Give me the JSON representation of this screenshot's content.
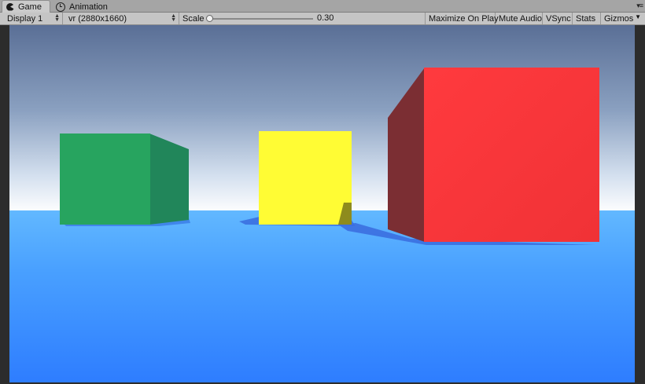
{
  "tabs": [
    {
      "label": "Game",
      "icon": "pacman-icon",
      "active": true
    },
    {
      "label": "Animation",
      "icon": "clock-icon",
      "active": false
    }
  ],
  "tab_menu_glyph": "▾≡",
  "toolbar": {
    "display": "Display 1",
    "resolution": "vr (2880x1660)",
    "scale_label": "Scale",
    "scale_value": "0.30",
    "maximize_on_play": "Maximize On Play",
    "mute_audio": "Mute Audio",
    "vsync": "VSync",
    "stats": "Stats",
    "gizmos": "Gizmos"
  },
  "scene": {
    "sky_top_color": "#5a6f96",
    "horizon_color": "#ffffff",
    "ground_color": "#3a8cff",
    "objects": [
      {
        "name": "green-cube",
        "color": "#27a45f"
      },
      {
        "name": "yellow-cube",
        "color": "#fffc34"
      },
      {
        "name": "red-cube",
        "color": "#ff3a3e"
      }
    ]
  }
}
